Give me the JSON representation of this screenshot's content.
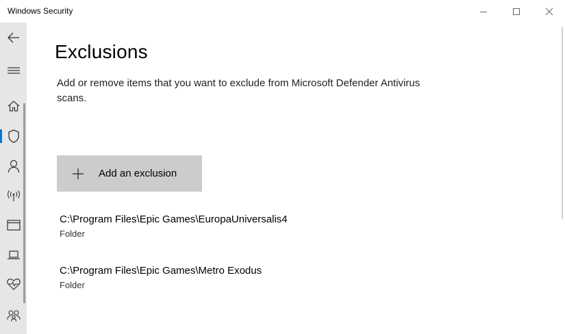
{
  "window": {
    "title": "Windows Security",
    "controls": [
      "minimize",
      "maximize",
      "close"
    ]
  },
  "sidebar": {
    "items": [
      {
        "icon": "back-arrow-icon"
      },
      {
        "icon": "hamburger-menu-icon"
      },
      {
        "icon": "home-icon"
      },
      {
        "icon": "shield-icon",
        "active": true
      },
      {
        "icon": "person-icon"
      },
      {
        "icon": "wireless-antenna-icon"
      },
      {
        "icon": "app-browser-icon"
      },
      {
        "icon": "laptop-icon"
      },
      {
        "icon": "heart-pulse-icon"
      },
      {
        "icon": "family-icon"
      }
    ],
    "active_indicator_color": "#0078d7"
  },
  "main": {
    "title": "Exclusions",
    "description": "Add or remove items that you want to exclude from Microsoft Defender Antivirus scans.",
    "add_button_label": "Add an exclusion",
    "exclusions": [
      {
        "path": "C:\\Program Files\\Epic Games\\EuropaUniversalis4",
        "type": "Folder"
      },
      {
        "path": "C:\\Program Files\\Epic Games\\Metro Exodus",
        "type": "Folder"
      }
    ]
  }
}
